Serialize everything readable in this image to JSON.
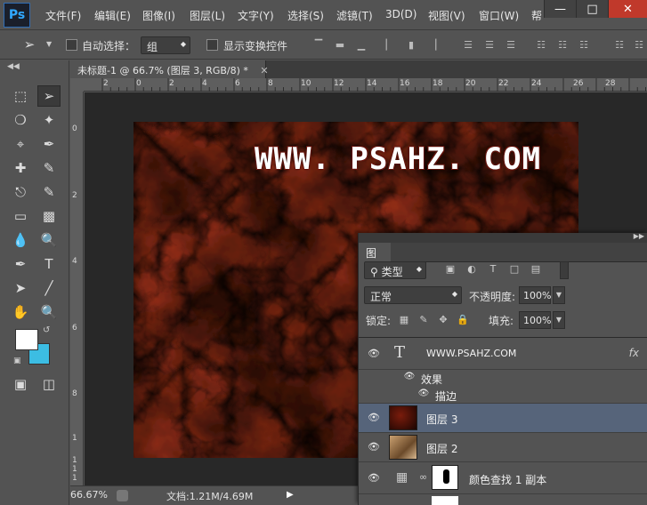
{
  "menubar": {
    "logo": "Ps",
    "items": [
      "文件(F)",
      "编辑(E)",
      "图像(I)",
      "图层(L)",
      "文字(Y)",
      "选择(S)",
      "滤镜(T)",
      "3D(D)",
      "视图(V)",
      "窗口(W)",
      "帮"
    ]
  },
  "options": {
    "auto_select_label": "自动选择：",
    "auto_select_value": "组",
    "transform_label": "显示变换控件"
  },
  "document": {
    "tab_title": "未标题-1 @ 66.7% (图层 3, RGB/8) *",
    "canvas_text": "WWW. PSAHZ. COM"
  },
  "rulers": {
    "top_labels": [
      "2",
      "0",
      "2",
      "4",
      "6",
      "8",
      "10",
      "12",
      "14",
      "16",
      "18",
      "20",
      "22",
      "24",
      "26",
      "28"
    ],
    "left_labels": [
      "0",
      "2",
      "4",
      "6",
      "8",
      "1",
      "1",
      "1",
      "1"
    ]
  },
  "status": {
    "zoom": "66.67%",
    "doc_info": "文档:1.21M/4.69M"
  },
  "layers_panel": {
    "tab": "图层",
    "filter_kind": "类型",
    "blend_mode": "正常",
    "opacity_label": "不透明度:",
    "opacity_value": "100%",
    "lock_label": "锁定:",
    "fill_label": "填充:",
    "fill_value": "100%",
    "layers": [
      {
        "name": "WWW.PSAHZ.COM",
        "type": "text",
        "fx": "fx"
      },
      {
        "name": "效果",
        "type": "effects"
      },
      {
        "name": "描边",
        "type": "effect"
      },
      {
        "name": "图层 3",
        "type": "pixel",
        "selected": true
      },
      {
        "name": "图层 2",
        "type": "pixel"
      },
      {
        "name": "颜色查找 1 副本",
        "type": "adjustment"
      }
    ]
  }
}
